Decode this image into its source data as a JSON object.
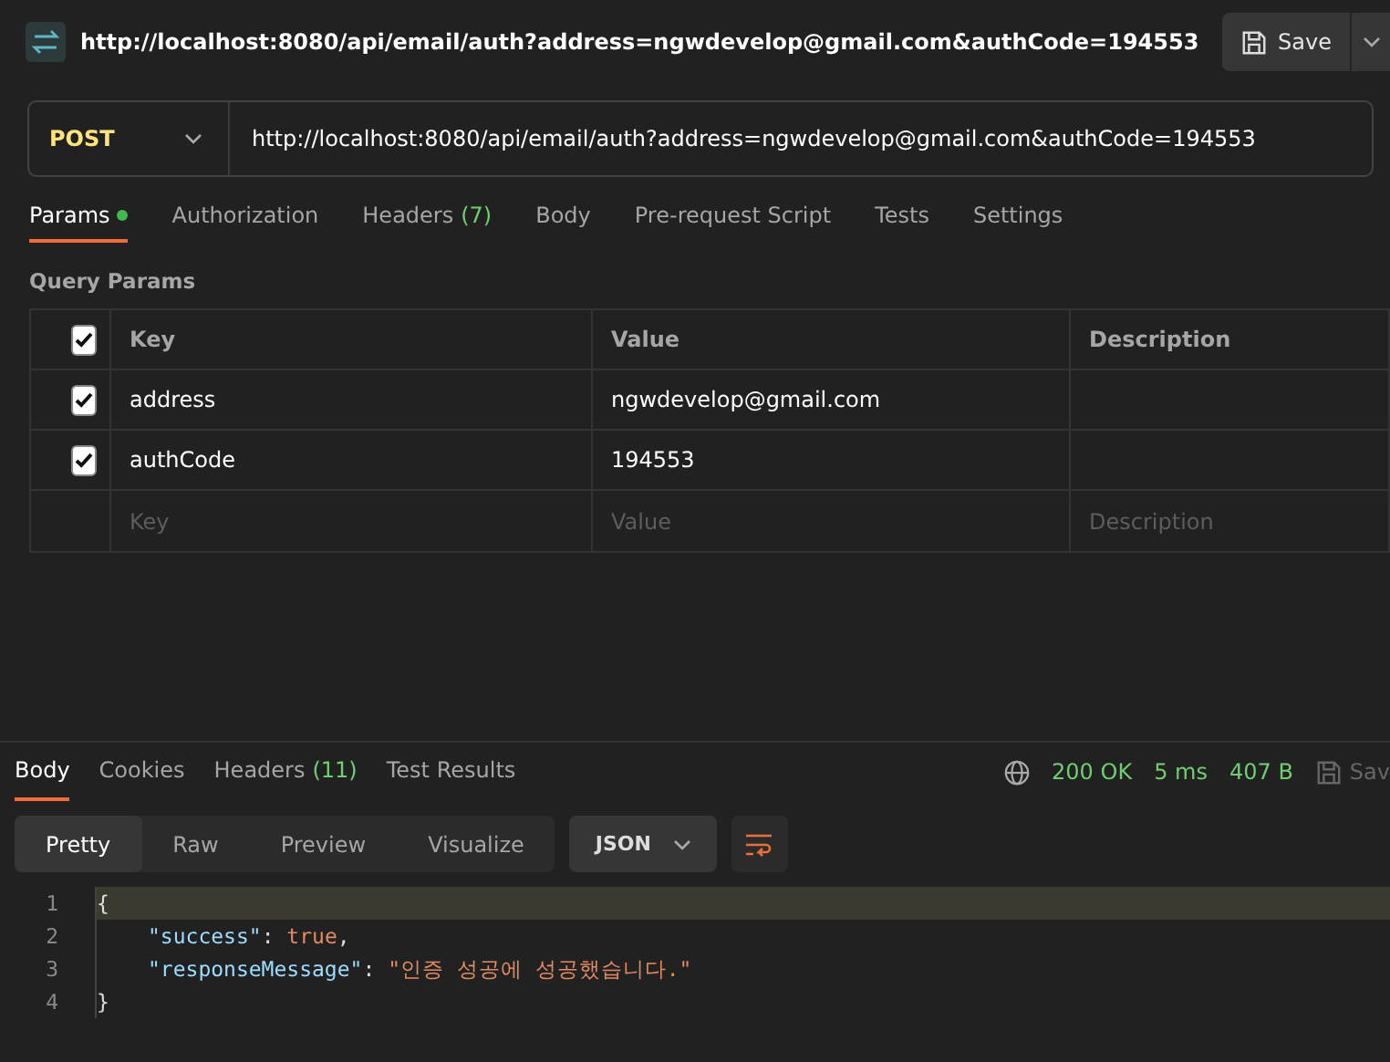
{
  "header": {
    "title": "http://localhost:8080/api/email/auth?address=ngwdevelop@gmail.com&authCode=194553",
    "save": "Save"
  },
  "request": {
    "method": "POST",
    "url": "http://localhost:8080/api/email/auth?address=ngwdevelop@gmail.com&authCode=194553"
  },
  "tabs": [
    {
      "label": "Params",
      "dot": true,
      "selected": true
    },
    {
      "label": "Authorization",
      "dot": false,
      "selected": false
    },
    {
      "label": "Headers",
      "count": "(7)",
      "dot": false,
      "selected": false
    },
    {
      "label": "Body",
      "dot": false,
      "selected": false
    },
    {
      "label": "Pre-request Script",
      "dot": false,
      "selected": false
    },
    {
      "label": "Tests",
      "dot": false,
      "selected": false
    },
    {
      "label": "Settings",
      "dot": false,
      "selected": false
    }
  ],
  "params": {
    "title": "Query Params",
    "all_checked": true,
    "columns": [
      "Key",
      "Value",
      "Description"
    ],
    "rows": [
      {
        "checked": true,
        "key": "address",
        "value": "ngwdevelop@gmail.com",
        "description": ""
      },
      {
        "checked": true,
        "key": "authCode",
        "value": "194553",
        "description": ""
      }
    ],
    "placeholders": [
      "Key",
      "Value",
      "Description"
    ]
  },
  "response": {
    "tabs": [
      {
        "label": "Body",
        "selected": true
      },
      {
        "label": "Cookies",
        "selected": false
      },
      {
        "label": "Headers",
        "count": "(11)",
        "selected": false
      },
      {
        "label": "Test Results",
        "selected": false
      }
    ],
    "status": "200 OK",
    "time": "5 ms",
    "size": "407 B",
    "save": "Sav",
    "views": [
      {
        "label": "Pretty",
        "selected": true
      },
      {
        "label": "Raw",
        "selected": false
      },
      {
        "label": "Preview",
        "selected": false
      },
      {
        "label": "Visualize",
        "selected": false
      }
    ],
    "format": "JSON",
    "code": [
      {
        "number": "1",
        "indented": false,
        "highlighted": true,
        "tokens": [
          {
            "kind": "punct",
            "text": "{"
          }
        ]
      },
      {
        "number": "2",
        "indented": true,
        "highlighted": false,
        "tokens": [
          {
            "kind": "key",
            "text": "\"success\""
          },
          {
            "kind": "punct",
            "text": ": "
          },
          {
            "kind": "literal",
            "text": "true"
          },
          {
            "kind": "punct",
            "text": ","
          }
        ]
      },
      {
        "number": "3",
        "indented": true,
        "highlighted": false,
        "tokens": [
          {
            "kind": "key",
            "text": "\"responseMessage\""
          },
          {
            "kind": "punct",
            "text": ": "
          },
          {
            "kind": "string",
            "text": "\"인증 성공에 성공했습니다.\""
          }
        ]
      },
      {
        "number": "4",
        "indented": false,
        "highlighted": false,
        "tokens": [
          {
            "kind": "punct",
            "text": "}"
          }
        ]
      }
    ]
  }
}
